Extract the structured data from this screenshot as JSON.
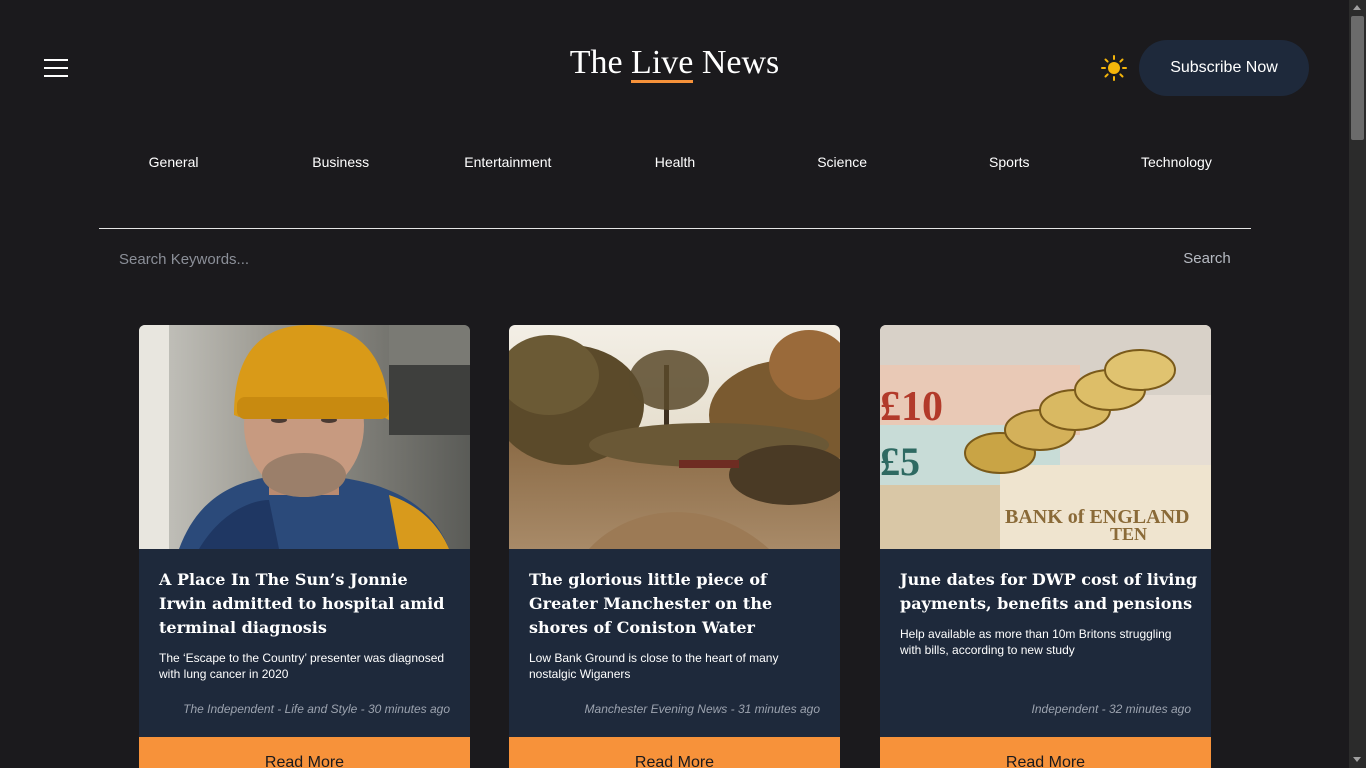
{
  "header": {
    "title_prefix": "The ",
    "title_highlight": "Live",
    "title_suffix": " News",
    "subscribe_label": "Subscribe Now",
    "menu_icon": "hamburger-menu-icon",
    "theme_icon": "sun-icon"
  },
  "nav": {
    "items": [
      "General",
      "Business",
      "Entertainment",
      "Health",
      "Science",
      "Sports",
      "Technology"
    ]
  },
  "search": {
    "placeholder": "Search Keywords...",
    "button_label": "Search"
  },
  "articles": [
    {
      "title": "A Place In The Sun’s Jonnie Irwin admitted to hospital amid terminal diagnosis",
      "description": "The ‘Escape to the Country’ presenter was diagnosed with lung cancer in 2020",
      "meta": "The Independent - Life and Style - 30 minutes ago",
      "read_more": "Read More"
    },
    {
      "title": "The glorious little piece of Greater Manchester on the shores of Coniston Water",
      "description": "Low Bank Ground is close to the heart of many nostalgic Wiganers",
      "meta": "Manchester Evening News - 31 minutes ago",
      "read_more": "Read More"
    },
    {
      "title": "June dates for DWP cost of living payments, benefits and pensions",
      "description": "Help available as more than 10m Britons struggling with bills, according to new study",
      "meta": "Independent - 32 minutes ago",
      "read_more": "Read More"
    }
  ],
  "colors": {
    "background": "#1b1a1d",
    "card": "#1e293b",
    "accent": "#f7923a",
    "button": "#1e293b",
    "sun": "#f5b50a"
  }
}
